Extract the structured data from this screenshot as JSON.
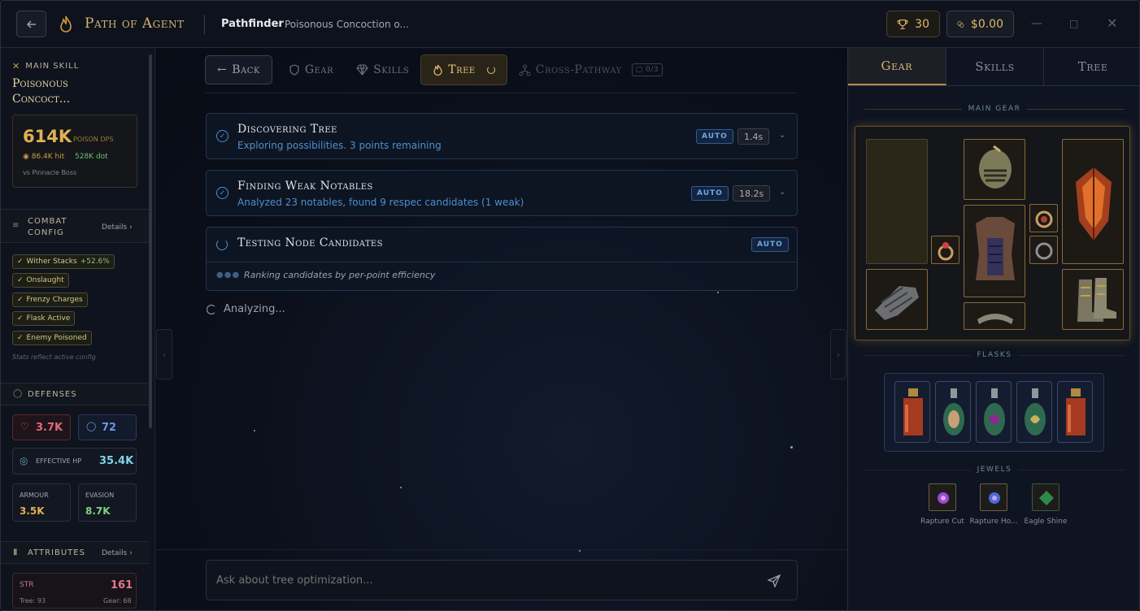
{
  "titlebar": {
    "back_icon": "arrow-left-icon",
    "app_title": "Path of Agent",
    "class_name": "Pathfinder",
    "build_name": "Poisonous Concoction o...",
    "trophy_count": "30",
    "balance": "$0.00"
  },
  "sidebar": {
    "main_skill_label": "MAIN SKILL",
    "main_skill_name_1": "Poisonous",
    "main_skill_name_2": "Concoct...",
    "dps_value": "614K",
    "dps_label": "POISON DPS",
    "hit_value": "86.4K hit",
    "dot_value": "528K dot",
    "vs_label": "vs Pinnacle Boss",
    "combat_label": "COMBAT CONFIG",
    "combat_details": "Details",
    "config": [
      {
        "label": "Wither Stacks",
        "extra": "+52.6%"
      },
      {
        "label": "Onslaught",
        "extra": ""
      },
      {
        "label": "Frenzy Charges",
        "extra": ""
      },
      {
        "label": "Flask Active",
        "extra": ""
      },
      {
        "label": "Enemy Poisoned",
        "extra": ""
      }
    ],
    "config_note": "Stats reflect active config",
    "defenses_label": "DEFENSES",
    "life": "3.7K",
    "es": "72",
    "ehp_label": "EFFECTIVE HP",
    "ehp_value": "35.4K",
    "armour_label": "ARMOUR",
    "armour_value": "3.5K",
    "evasion_label": "EVASION",
    "evasion_value": "8.7K",
    "attributes_label": "ATTRIBUTES",
    "attributes_details": "Details",
    "str_label": "STR",
    "str_value": "161",
    "str_tree": "Tree: 93",
    "str_gear": "Gear: 68"
  },
  "tabs": {
    "back": "Back",
    "gear": "Gear",
    "skills": "Skills",
    "tree": "Tree",
    "cross": "Cross-Pathway",
    "cross_badge": "0/3"
  },
  "steps": [
    {
      "title": "Discovering Tree",
      "subtitle": "Exploring possibilities. 3 points remaining",
      "badge": "AUTO",
      "duration": "1.4s"
    },
    {
      "title": "Finding Weak Notables",
      "subtitle": "Analyzed 23 notables, found 9 respec candidates (1 weak)",
      "badge": "AUTO",
      "duration": "18.2s"
    },
    {
      "title": "Testing Node Candidates",
      "subtitle": "Ranking candidates by per-point efficiency",
      "badge": "AUTO"
    }
  ],
  "status_text": "Analyzing...",
  "ask_placeholder": "Ask about tree optimization...",
  "right": {
    "tabs": [
      "Gear",
      "Skills",
      "Tree"
    ],
    "main_gear_label": "MAIN GEAR",
    "flasks_label": "FLASKS",
    "jewels_label": "JEWELS",
    "jewels": [
      "Rapture Cut",
      "Rapture Ho...",
      "Eagle Shine"
    ]
  },
  "colors": {
    "accent_gold": "#d6b375",
    "accent_blue": "#4c8fd0"
  }
}
